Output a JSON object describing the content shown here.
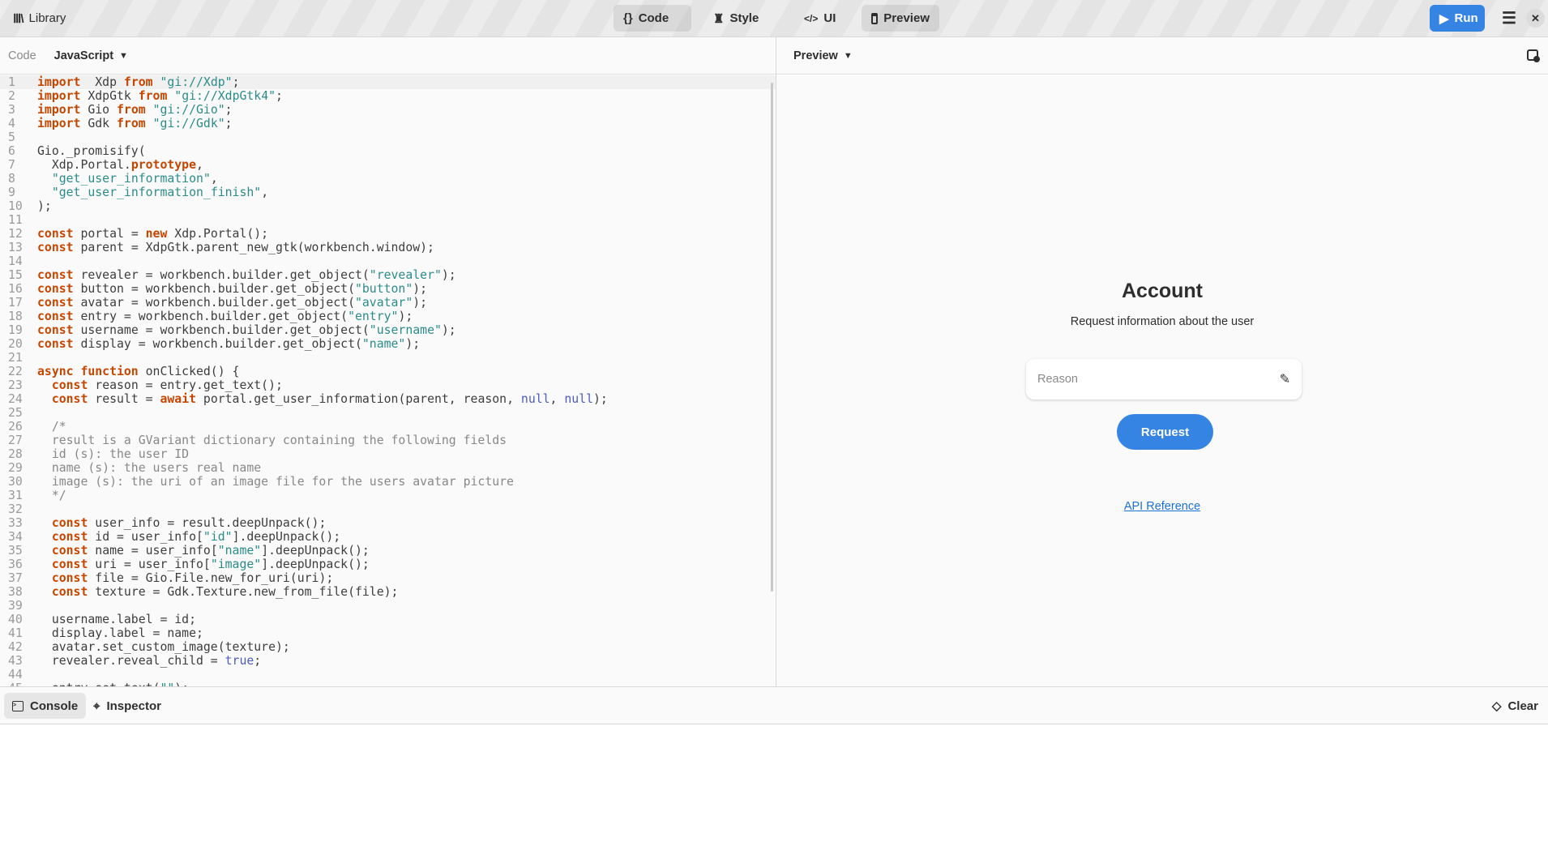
{
  "header": {
    "library": "Library",
    "tabs": [
      {
        "label": "Code",
        "icon": "braces-icon",
        "active": true
      },
      {
        "label": "Style",
        "icon": "brush-icon",
        "active": false
      },
      {
        "label": "UI",
        "icon": "code-tag-icon",
        "active": false
      },
      {
        "label": "Preview",
        "icon": "window-icon",
        "active": true
      }
    ],
    "run": "Run",
    "accent": "#3584e4"
  },
  "code_panel": {
    "label": "Code",
    "language": "JavaScript"
  },
  "preview_panel": {
    "label": "Preview"
  },
  "preview": {
    "title": "Account",
    "subtitle": "Request information about the user",
    "reason_placeholder": "Reason",
    "request": "Request",
    "api_reference": "API Reference"
  },
  "bottom": {
    "console": "Console",
    "inspector": "Inspector",
    "clear": "Clear"
  },
  "code_lines": [
    [
      [
        "k",
        "import"
      ],
      [
        "",
        "  Xdp "
      ],
      [
        "k",
        "from"
      ],
      [
        "",
        " "
      ],
      [
        "s",
        "\"gi://Xdp\""
      ],
      [
        "",
        ";"
      ]
    ],
    [
      [
        "k",
        "import"
      ],
      [
        "",
        " XdpGtk "
      ],
      [
        "k",
        "from"
      ],
      [
        "",
        " "
      ],
      [
        "s",
        "\"gi://XdpGtk4\""
      ],
      [
        "",
        ";"
      ]
    ],
    [
      [
        "k",
        "import"
      ],
      [
        "",
        " Gio "
      ],
      [
        "k",
        "from"
      ],
      [
        "",
        " "
      ],
      [
        "s",
        "\"gi://Gio\""
      ],
      [
        "",
        ";"
      ]
    ],
    [
      [
        "k",
        "import"
      ],
      [
        "",
        " Gdk "
      ],
      [
        "k",
        "from"
      ],
      [
        "",
        " "
      ],
      [
        "s",
        "\"gi://Gdk\""
      ],
      [
        "",
        ";"
      ]
    ],
    [],
    [
      [
        "",
        "Gio._promisify("
      ]
    ],
    [
      [
        "",
        "  Xdp.Portal."
      ],
      [
        "k",
        "prototype"
      ],
      [
        "",
        ","
      ]
    ],
    [
      [
        "",
        "  "
      ],
      [
        "s",
        "\"get_user_information\""
      ],
      [
        "",
        ","
      ]
    ],
    [
      [
        "",
        "  "
      ],
      [
        "s",
        "\"get_user_information_finish\""
      ],
      [
        "",
        ","
      ]
    ],
    [
      [
        "",
        ");"
      ]
    ],
    [],
    [
      [
        "k",
        "const"
      ],
      [
        "",
        " portal = "
      ],
      [
        "k",
        "new"
      ],
      [
        "",
        " Xdp.Portal();"
      ]
    ],
    [
      [
        "k",
        "const"
      ],
      [
        "",
        " parent = XdpGtk.parent_new_gtk(workbench.window);"
      ]
    ],
    [],
    [
      [
        "k",
        "const"
      ],
      [
        "",
        " revealer = workbench.builder.get_object("
      ],
      [
        "s",
        "\"revealer\""
      ],
      [
        "",
        ");"
      ]
    ],
    [
      [
        "k",
        "const"
      ],
      [
        "",
        " button = workbench.builder.get_object("
      ],
      [
        "s",
        "\"button\""
      ],
      [
        "",
        ");"
      ]
    ],
    [
      [
        "k",
        "const"
      ],
      [
        "",
        " avatar = workbench.builder.get_object("
      ],
      [
        "s",
        "\"avatar\""
      ],
      [
        "",
        ");"
      ]
    ],
    [
      [
        "k",
        "const"
      ],
      [
        "",
        " entry = workbench.builder.get_object("
      ],
      [
        "s",
        "\"entry\""
      ],
      [
        "",
        ");"
      ]
    ],
    [
      [
        "k",
        "const"
      ],
      [
        "",
        " username = workbench.builder.get_object("
      ],
      [
        "s",
        "\"username\""
      ],
      [
        "",
        ");"
      ]
    ],
    [
      [
        "k",
        "const"
      ],
      [
        "",
        " display = workbench.builder.get_object("
      ],
      [
        "s",
        "\"name\""
      ],
      [
        "",
        ");"
      ]
    ],
    [],
    [
      [
        "k",
        "async function"
      ],
      [
        "",
        " onClicked() {"
      ]
    ],
    [
      [
        "",
        "  "
      ],
      [
        "k",
        "const"
      ],
      [
        "",
        " reason = entry.get_text();"
      ]
    ],
    [
      [
        "",
        "  "
      ],
      [
        "k",
        "const"
      ],
      [
        "",
        " result = "
      ],
      [
        "k",
        "await"
      ],
      [
        "",
        " portal.get_user_information(parent, reason, "
      ],
      [
        "n",
        "null"
      ],
      [
        "",
        ", "
      ],
      [
        "n",
        "null"
      ],
      [
        "",
        ");"
      ]
    ],
    [],
    [
      [
        "c",
        "  /*"
      ]
    ],
    [
      [
        "c",
        "  result is a GVariant dictionary containing the following fields"
      ]
    ],
    [
      [
        "c",
        "  id (s): the user ID"
      ]
    ],
    [
      [
        "c",
        "  name (s): the users real name"
      ]
    ],
    [
      [
        "c",
        "  image (s): the uri of an image file for the users avatar picture"
      ]
    ],
    [
      [
        "c",
        "  */"
      ]
    ],
    [],
    [
      [
        "",
        "  "
      ],
      [
        "k",
        "const"
      ],
      [
        "",
        " user_info = result.deepUnpack();"
      ]
    ],
    [
      [
        "",
        "  "
      ],
      [
        "k",
        "const"
      ],
      [
        "",
        " id = user_info["
      ],
      [
        "s",
        "\"id\""
      ],
      [
        "",
        "].deepUnpack();"
      ]
    ],
    [
      [
        "",
        "  "
      ],
      [
        "k",
        "const"
      ],
      [
        "",
        " name = user_info["
      ],
      [
        "s",
        "\"name\""
      ],
      [
        "",
        "].deepUnpack();"
      ]
    ],
    [
      [
        "",
        "  "
      ],
      [
        "k",
        "const"
      ],
      [
        "",
        " uri = user_info["
      ],
      [
        "s",
        "\"image\""
      ],
      [
        "",
        "].deepUnpack();"
      ]
    ],
    [
      [
        "",
        "  "
      ],
      [
        "k",
        "const"
      ],
      [
        "",
        " file = Gio.File.new_for_uri(uri);"
      ]
    ],
    [
      [
        "",
        "  "
      ],
      [
        "k",
        "const"
      ],
      [
        "",
        " texture = Gdk.Texture.new_from_file(file);"
      ]
    ],
    [],
    [
      [
        "",
        "  username.label = id;"
      ]
    ],
    [
      [
        "",
        "  display.label = name;"
      ]
    ],
    [
      [
        "",
        "  avatar.set_custom_image(texture);"
      ]
    ],
    [
      [
        "",
        "  revealer.reveal_child = "
      ],
      [
        "n",
        "true"
      ],
      [
        "",
        ";"
      ]
    ],
    [],
    [
      [
        "",
        "  entry.set_text("
      ],
      [
        "s",
        "\"\""
      ],
      [
        "",
        ");"
      ]
    ]
  ]
}
